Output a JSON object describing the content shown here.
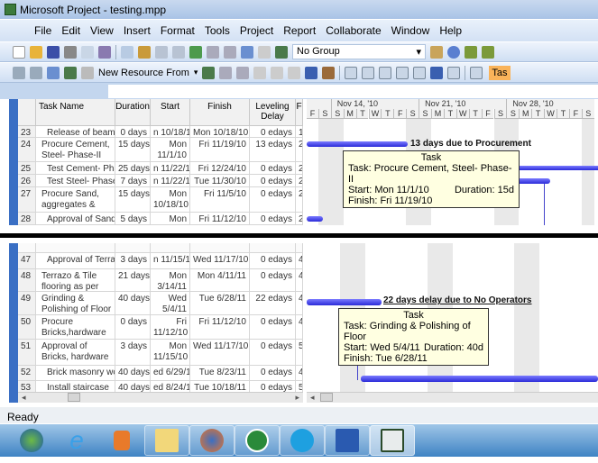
{
  "window": {
    "title": "Microsoft Project - testing.mpp"
  },
  "menu": [
    "File",
    "Edit",
    "View",
    "Insert",
    "Format",
    "Tools",
    "Project",
    "Report",
    "Collaborate",
    "Window",
    "Help"
  ],
  "toolbar": {
    "group_select": "No Group",
    "new_resource_from": "New Resource From",
    "task_button": "Tas"
  },
  "table": {
    "headers": [
      "Task Name",
      "Duration",
      "Start",
      "Finish",
      "Leveling Delay",
      "F"
    ],
    "top_rows": [
      {
        "id": "23",
        "name": "Release of beam",
        "duration": "0 days",
        "start": "n 10/18/10",
        "finish": "Mon 10/18/10",
        "delay": "0 edays",
        "f": "1"
      },
      {
        "id": "24",
        "name": "Procure Cement, Steel- Phase-II",
        "duration": "15 days",
        "start": "Mon 11/1/10",
        "finish": "Fri 11/19/10",
        "delay": "13 edays",
        "f": "2"
      },
      {
        "id": "25",
        "name": "Test Cement- Pha",
        "duration": "25 days",
        "start": "n 11/22/10",
        "finish": "Fri 12/24/10",
        "delay": "0 edays",
        "f": "2"
      },
      {
        "id": "26",
        "name": "Test Steel- Phase",
        "duration": "7 days",
        "start": "n 11/22/10",
        "finish": "Tue 11/30/10",
        "delay": "0 edays",
        "f": "2"
      },
      {
        "id": "27",
        "name": "Procure Sand, aggregates &",
        "duration": "15 days",
        "start": "Mon 10/18/10",
        "finish": "Fri 11/5/10",
        "delay": "0 edays",
        "f": "2"
      },
      {
        "id": "28",
        "name": "Approval of Sand,",
        "duration": "5 days",
        "start": "Mon",
        "finish": "Fri 11/12/10",
        "delay": "0 edays",
        "f": "2"
      }
    ],
    "bottom_rows": [
      {
        "id": "47",
        "name": "Approval of Terraz",
        "duration": "3 days",
        "start": "n 11/15/10",
        "finish": "Wed 11/17/10",
        "delay": "0 edays",
        "f": "4"
      },
      {
        "id": "48",
        "name": "Terrazo & Tile flooring as per",
        "duration": "21 days",
        "start": "Mon 3/14/11",
        "finish": "Mon 4/11/11",
        "delay": "0 edays",
        "f": "4"
      },
      {
        "id": "49",
        "name": "Grinding & Polishing of Floor",
        "duration": "40 days",
        "start": "Wed 5/4/11",
        "finish": "Tue 6/28/11",
        "delay": "22 edays",
        "f": "4"
      },
      {
        "id": "50",
        "name": "Procure Bricks,hardware",
        "duration": "0 days",
        "start": "Fri 11/12/10",
        "finish": "Fri 11/12/10",
        "delay": "0 edays",
        "f": "4"
      },
      {
        "id": "51",
        "name": "Approval of Bricks, hardware",
        "duration": "3 days",
        "start": "Mon 11/15/10",
        "finish": "Wed 11/17/10",
        "delay": "0 edays",
        "f": "5"
      },
      {
        "id": "52",
        "name": "Brick masonry wc",
        "duration": "40 days",
        "start": "ed 6/29/11",
        "finish": "Tue 8/23/11",
        "delay": "0 edays",
        "f": "4"
      },
      {
        "id": "53",
        "name": "Install staircase",
        "duration": "40 days",
        "start": "ed 8/24/11",
        "finish": "Tue 10/18/11",
        "delay": "0 edays",
        "f": "5"
      }
    ]
  },
  "gantt": {
    "weeks": [
      "Nov 14, '10",
      "Nov 21, '10",
      "Nov 28, '10"
    ],
    "days": [
      "F",
      "S",
      "S",
      "M",
      "T",
      "W",
      "T",
      "F",
      "S",
      "S",
      "M",
      "T",
      "W",
      "T",
      "F",
      "S",
      "S",
      "M",
      "T",
      "W",
      "T",
      "F",
      "S"
    ],
    "annotation_top": "13 days due to Procurement",
    "annotation_bottom": "22 days delay due to No Operators",
    "tooltip_top": {
      "title": "Task",
      "task": "Task: Procure Cement, Steel- Phase-II",
      "start": "Start: Mon 11/1/10",
      "duration": "Duration: 15d",
      "finish": "Finish: Fri 11/19/10"
    },
    "tooltip_bottom": {
      "title": "Task",
      "task": "Task: Grinding & Polishing of Floor",
      "start": "Start: Wed 5/4/11",
      "duration": "Duration: 40d",
      "finish": "Finish: Tue 6/28/11"
    }
  },
  "status": "Ready",
  "taskbar": [
    "start-orb",
    "internet-explorer",
    "media-player",
    "windows-explorer",
    "firefox",
    "utorrent",
    "skype",
    "word",
    "project"
  ]
}
